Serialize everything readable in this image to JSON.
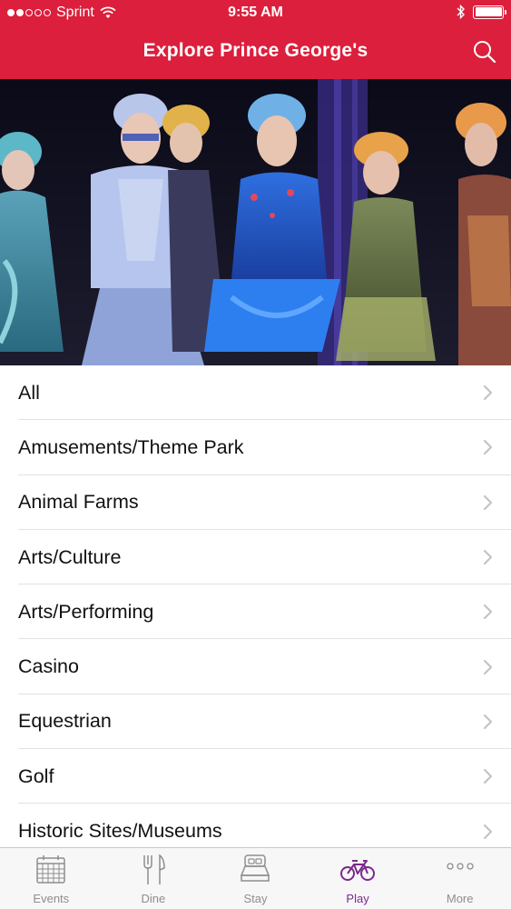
{
  "status_bar": {
    "carrier": "Sprint",
    "time": "9:55 AM",
    "signal_bars_filled": 2,
    "signal_bars_total": 5
  },
  "nav": {
    "title": "Explore Prince George's",
    "search_icon": "search-icon"
  },
  "hero": {
    "icon": "hero-photo"
  },
  "categories": [
    {
      "label": "All"
    },
    {
      "label": "Amusements/Theme Park"
    },
    {
      "label": "Animal Farms"
    },
    {
      "label": "Arts/Culture"
    },
    {
      "label": "Arts/Performing"
    },
    {
      "label": "Casino"
    },
    {
      "label": "Equestrian"
    },
    {
      "label": "Golf"
    },
    {
      "label": "Historic Sites/Museums"
    }
  ],
  "tabs": [
    {
      "label": "Events",
      "icon": "calendar-icon",
      "active": false
    },
    {
      "label": "Dine",
      "icon": "fork-knife-icon",
      "active": false
    },
    {
      "label": "Stay",
      "icon": "bed-icon",
      "active": false
    },
    {
      "label": "Play",
      "icon": "bicycle-icon",
      "active": true
    },
    {
      "label": "More",
      "icon": "more-dots-icon",
      "active": false
    }
  ],
  "colors": {
    "header_bg": "#dc1f3c",
    "active_tab": "#7a2b8c",
    "inactive_tab": "#8e8e8e"
  }
}
